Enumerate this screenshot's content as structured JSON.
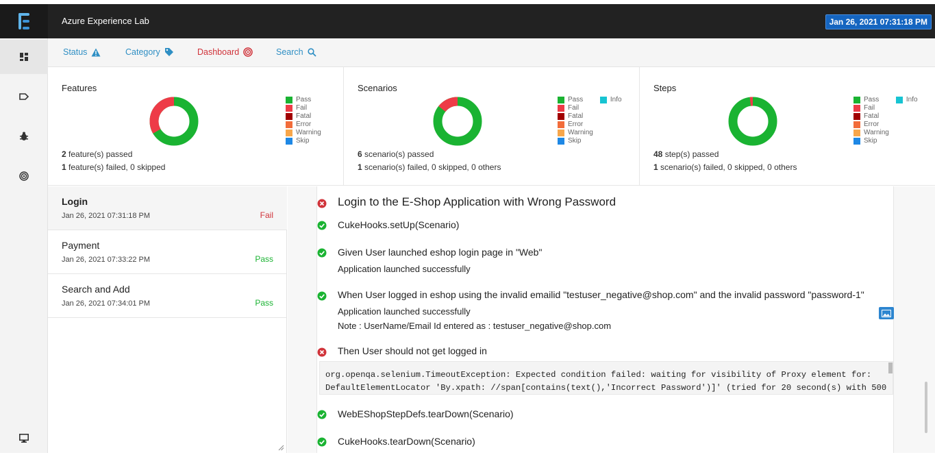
{
  "app": {
    "title": "Azure Experience Lab",
    "date": "Jan 26, 2021 07:31:18 PM"
  },
  "nav": {
    "status": "Status",
    "category": "Category",
    "dashboard": "Dashboard",
    "search": "Search"
  },
  "colors": {
    "pass": "#1ab332",
    "fail": "#ee3b47",
    "fatal": "#a10000",
    "error": "#f26c3a",
    "warning": "#f7a64b",
    "skip": "#1e88e5",
    "info": "#17c4d2"
  },
  "legend_labels": {
    "pass": "Pass",
    "fail": "Fail",
    "fatal": "Fatal",
    "error": "Error",
    "warning": "Warning",
    "skip": "Skip",
    "info": "Info"
  },
  "stats": {
    "features": {
      "title": "Features",
      "passed_count": "2",
      "passed_text": " feature(s) passed",
      "failed_count": "1",
      "failed_text": " feature(s) failed, 0 skipped",
      "pass": 2,
      "fail": 1
    },
    "scenarios": {
      "title": "Scenarios",
      "passed_count": "6",
      "passed_text": " scenario(s) passed",
      "failed_count": "1",
      "failed_text": " scenario(s) failed, 0 skipped, 0 others",
      "pass": 6,
      "fail": 1
    },
    "steps": {
      "title": "Steps",
      "passed_count": "48",
      "passed_text": " step(s) passed",
      "failed_count": "1",
      "failed_text": " scenario(s) failed, 0 skipped, 0 others",
      "pass": 48,
      "fail": 1
    }
  },
  "tests": [
    {
      "name": "Login",
      "date": "Jan 26, 2021 07:31:18 PM",
      "status": "Fail"
    },
    {
      "name": "Payment",
      "date": "Jan 26, 2021 07:33:22 PM",
      "status": "Pass"
    },
    {
      "name": "Search and Add",
      "date": "Jan 26, 2021 07:34:01 PM",
      "status": "Pass"
    }
  ],
  "detail": {
    "title": "Login to the E-Shop Application with Wrong Password",
    "steps": [
      {
        "text": "CukeHooks.setUp(Scenario)",
        "status": "pass"
      },
      {
        "text": "Given User launched eshop login page in \"Web\"",
        "status": "pass",
        "logs": [
          "Application launched successfully"
        ]
      },
      {
        "text": "When User logged in eshop using the invalid emailid \"testuser_negative@shop.com\" and the invalid password \"password-1\"",
        "status": "pass",
        "logs": [
          "Application launched successfully",
          "Note : UserName/Email Id entered as : testuser_negative@shop.com"
        ]
      },
      {
        "text": "Then User should not get logged in",
        "status": "fail"
      },
      {
        "text": "WebEShopStepDefs.tearDown(Scenario)",
        "status": "pass"
      },
      {
        "text": "CukeHooks.tearDown(Scenario)",
        "status": "pass"
      }
    ],
    "exception_line1": "org.openqa.selenium.TimeoutException: Expected condition failed: waiting for visibility of Proxy element for:",
    "exception_line2": "DefaultElementLocator 'By.xpath: //span[contains(text(),'Incorrect Password')]' (tried for 20 second(s) with 500"
  }
}
